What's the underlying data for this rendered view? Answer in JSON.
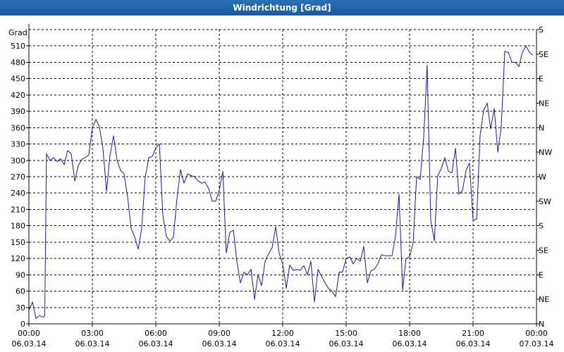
{
  "window": {
    "title": "Windrichtung [Grad]"
  },
  "chart_data": {
    "type": "line",
    "title": "Windrichtung [Grad]",
    "ylabel": "Grad",
    "ylim": [
      0,
      540
    ],
    "yticks": [
      0,
      30,
      60,
      90,
      120,
      150,
      180,
      210,
      240,
      270,
      300,
      330,
      360,
      390,
      420,
      450,
      480,
      510
    ],
    "right_axis_labels": [
      {
        "y": 0,
        "label": "N"
      },
      {
        "y": 45,
        "label": "NE"
      },
      {
        "y": 90,
        "label": "E"
      },
      {
        "y": 135,
        "label": "SE"
      },
      {
        "y": 180,
        "label": "S"
      },
      {
        "y": 225,
        "label": "SW"
      },
      {
        "y": 270,
        "label": "W"
      },
      {
        "y": 315,
        "label": "NW"
      },
      {
        "y": 360,
        "label": "N"
      },
      {
        "y": 405,
        "label": "NE"
      },
      {
        "y": 450,
        "label": "E"
      },
      {
        "y": 495,
        "label": "SE"
      },
      {
        "y": 540,
        "label": "S"
      }
    ],
    "xlim": [
      0,
      24
    ],
    "xticks": [
      {
        "x": 0,
        "time": "00:00",
        "date": "06.03.14"
      },
      {
        "x": 3,
        "time": "03:00",
        "date": "06.03.14"
      },
      {
        "x": 6,
        "time": "06:00",
        "date": "06.03.14"
      },
      {
        "x": 9,
        "time": "09:00",
        "date": "06.03.14"
      },
      {
        "x": 12,
        "time": "12:00",
        "date": "06.03.14"
      },
      {
        "x": 15,
        "time": "15:00",
        "date": "06.03.14"
      },
      {
        "x": 18,
        "time": "18:00",
        "date": "06.03.14"
      },
      {
        "x": 21,
        "time": "21:00",
        "date": "06.03.14"
      },
      {
        "x": 24,
        "time": "00:00",
        "date": "07.03.14"
      }
    ],
    "grid": true,
    "colors": {
      "line": "#1a1aa0",
      "grid": "#000000",
      "title_bar": "#1f5fa3"
    },
    "series": [
      {
        "name": "",
        "points": [
          [
            0.0,
            25
          ],
          [
            0.17,
            40
          ],
          [
            0.33,
            10
          ],
          [
            0.5,
            15
          ],
          [
            0.67,
            12
          ],
          [
            0.75,
            15
          ],
          [
            0.83,
            312
          ],
          [
            1.0,
            300
          ],
          [
            1.17,
            305
          ],
          [
            1.33,
            298
          ],
          [
            1.5,
            303
          ],
          [
            1.67,
            292
          ],
          [
            1.83,
            318
          ],
          [
            2.0,
            312
          ],
          [
            2.17,
            262
          ],
          [
            2.33,
            290
          ],
          [
            2.5,
            302
          ],
          [
            2.67,
            305
          ],
          [
            2.83,
            310
          ],
          [
            3.0,
            360
          ],
          [
            3.17,
            375
          ],
          [
            3.33,
            362
          ],
          [
            3.5,
            322
          ],
          [
            3.67,
            243
          ],
          [
            3.83,
            308
          ],
          [
            4.0,
            345
          ],
          [
            4.17,
            300
          ],
          [
            4.33,
            282
          ],
          [
            4.5,
            275
          ],
          [
            4.67,
            232
          ],
          [
            4.83,
            175
          ],
          [
            5.0,
            160
          ],
          [
            5.17,
            137
          ],
          [
            5.33,
            175
          ],
          [
            5.5,
            270
          ],
          [
            5.67,
            305
          ],
          [
            5.83,
            307
          ],
          [
            6.0,
            323
          ],
          [
            6.17,
            330
          ],
          [
            6.33,
            200
          ],
          [
            6.5,
            160
          ],
          [
            6.67,
            152
          ],
          [
            6.83,
            158
          ],
          [
            7.0,
            230
          ],
          [
            7.17,
            283
          ],
          [
            7.33,
            258
          ],
          [
            7.5,
            275
          ],
          [
            7.67,
            272
          ],
          [
            7.83,
            270
          ],
          [
            8.0,
            262
          ],
          [
            8.17,
            258
          ],
          [
            8.33,
            260
          ],
          [
            8.5,
            248
          ],
          [
            8.67,
            225
          ],
          [
            8.83,
            225
          ],
          [
            9.0,
            245
          ],
          [
            9.17,
            280
          ],
          [
            9.33,
            130
          ],
          [
            9.5,
            168
          ],
          [
            9.67,
            172
          ],
          [
            9.83,
            115
          ],
          [
            10.0,
            75
          ],
          [
            10.17,
            95
          ],
          [
            10.33,
            90
          ],
          [
            10.5,
            100
          ],
          [
            10.67,
            45
          ],
          [
            10.83,
            90
          ],
          [
            11.0,
            70
          ],
          [
            11.17,
            115
          ],
          [
            11.33,
            128
          ],
          [
            11.5,
            140
          ],
          [
            11.67,
            178
          ],
          [
            11.83,
            130
          ],
          [
            12.0,
            110
          ],
          [
            12.17,
            65
          ],
          [
            12.33,
            108
          ],
          [
            12.5,
            98
          ],
          [
            12.67,
            100
          ],
          [
            12.83,
            98
          ],
          [
            13.0,
            107
          ],
          [
            13.17,
            90
          ],
          [
            13.33,
            115
          ],
          [
            13.5,
            40
          ],
          [
            13.67,
            100
          ],
          [
            13.83,
            88
          ],
          [
            14.0,
            75
          ],
          [
            14.17,
            65
          ],
          [
            14.33,
            60
          ],
          [
            14.5,
            50
          ],
          [
            14.67,
            95
          ],
          [
            14.83,
            95
          ],
          [
            15.0,
            120
          ],
          [
            15.17,
            123
          ],
          [
            15.33,
            110
          ],
          [
            15.5,
            120
          ],
          [
            15.67,
            115
          ],
          [
            15.83,
            142
          ],
          [
            16.0,
            75
          ],
          [
            16.17,
            97
          ],
          [
            16.33,
            100
          ],
          [
            16.5,
            110
          ],
          [
            16.67,
            127
          ],
          [
            16.83,
            125
          ],
          [
            17.0,
            125
          ],
          [
            17.17,
            125
          ],
          [
            17.33,
            160
          ],
          [
            17.5,
            238
          ],
          [
            17.67,
            62
          ],
          [
            17.83,
            120
          ],
          [
            18.0,
            123
          ],
          [
            18.17,
            150
          ],
          [
            18.33,
            270
          ],
          [
            18.5,
            265
          ],
          [
            18.67,
            345
          ],
          [
            18.83,
            475
          ],
          [
            19.0,
            190
          ],
          [
            19.17,
            152
          ],
          [
            19.33,
            272
          ],
          [
            19.5,
            285
          ],
          [
            19.67,
            305
          ],
          [
            19.83,
            280
          ],
          [
            20.0,
            277
          ],
          [
            20.17,
            322
          ],
          [
            20.33,
            238
          ],
          [
            20.5,
            245
          ],
          [
            20.67,
            282
          ],
          [
            20.83,
            295
          ],
          [
            21.0,
            190
          ],
          [
            21.17,
            192
          ],
          [
            21.33,
            345
          ],
          [
            21.5,
            392
          ],
          [
            21.67,
            405
          ],
          [
            21.83,
            358
          ],
          [
            22.0,
            395
          ],
          [
            22.17,
            315
          ],
          [
            22.33,
            360
          ],
          [
            22.5,
            500
          ],
          [
            22.67,
            498
          ],
          [
            22.83,
            480
          ],
          [
            23.0,
            480
          ],
          [
            23.17,
            472
          ],
          [
            23.33,
            498
          ],
          [
            23.5,
            510
          ],
          [
            23.67,
            498
          ],
          [
            23.83,
            493
          ]
        ]
      }
    ]
  }
}
